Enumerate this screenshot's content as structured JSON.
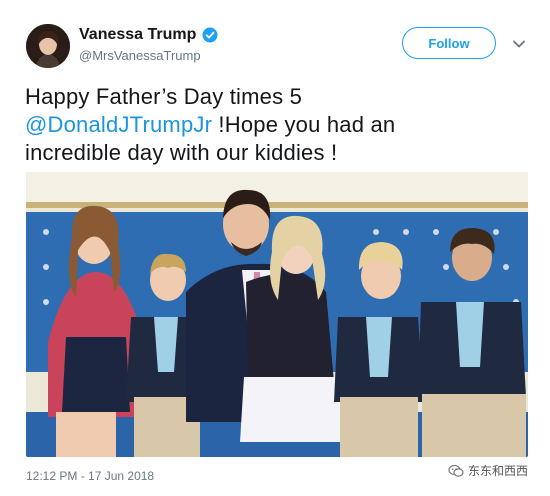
{
  "user": {
    "display_name": "Vanessa Trump",
    "handle": "@MrsVanessaTrump",
    "verified": true
  },
  "follow_label": "Follow",
  "tweet": {
    "line1": "Happy Father’s Day times 5",
    "mention": "@DonaldJTrumpJr",
    "line2_rest": " !Hope you had an",
    "line3": "incredible day with our kiddies !"
  },
  "timestamp": "12:12 PM - 17 Jun 2018",
  "watermark": "东东和西西",
  "colors": {
    "accent": "#1da1f2",
    "link": "#1b95e0",
    "muted": "#657786",
    "sofa_blue": "#2f6db3"
  }
}
